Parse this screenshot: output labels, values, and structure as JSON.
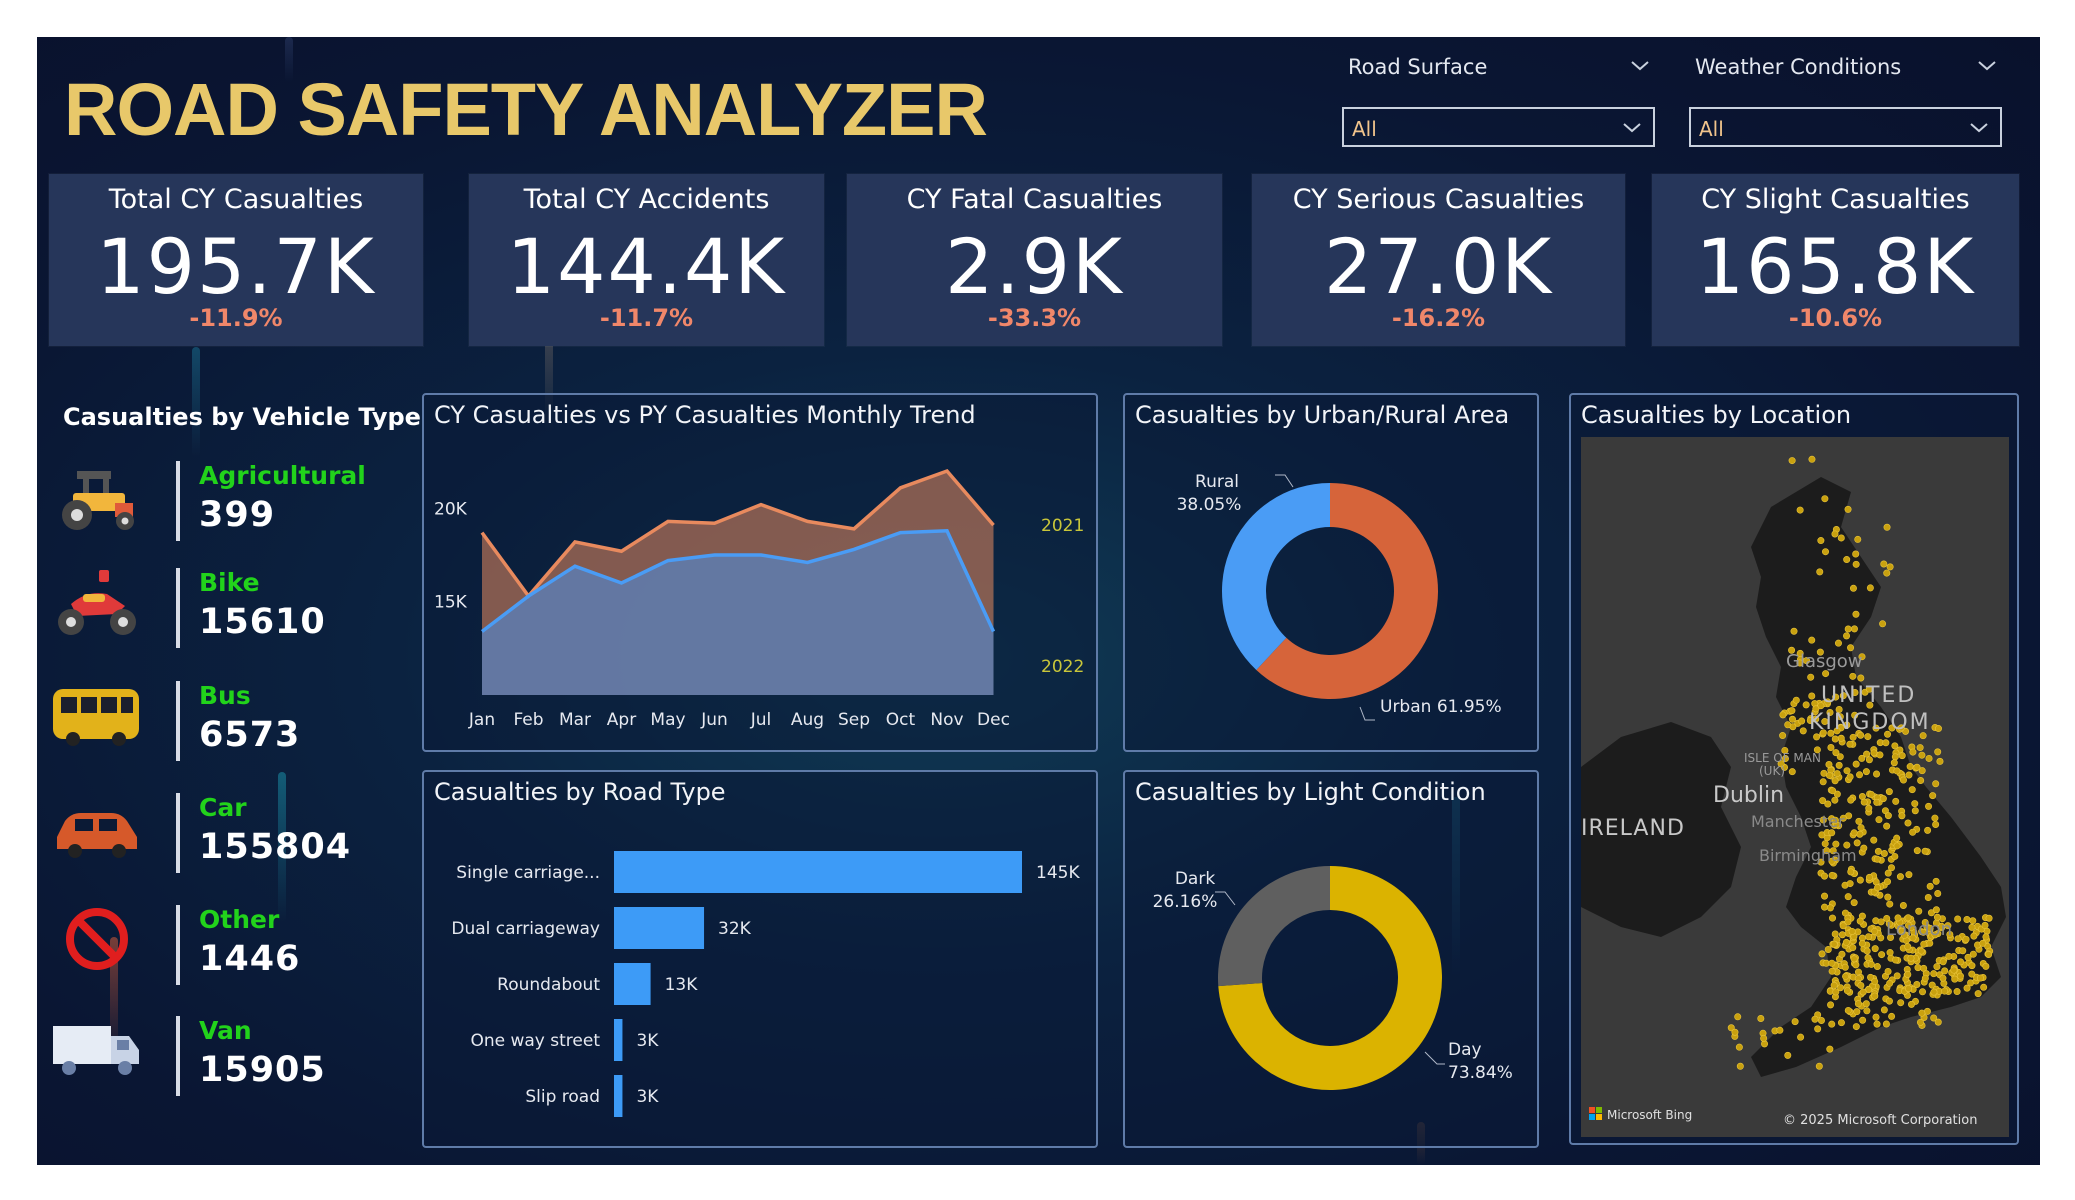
{
  "title": "ROAD SAFETY ANALYZER",
  "slicers": {
    "road_surface": {
      "label": "Road Surface",
      "value": "All"
    },
    "weather": {
      "label": "Weather Conditions",
      "value": "All"
    }
  },
  "kpis": [
    {
      "title": "Total CY Casualties",
      "value": "195.7K",
      "delta": "-11.9%"
    },
    {
      "title": "Total CY Accidents",
      "value": "144.4K",
      "delta": "-11.7%"
    },
    {
      "title": "CY Fatal Casualties",
      "value": "2.9K",
      "delta": "-33.3%"
    },
    {
      "title": "CY Serious Casualties",
      "value": "27.0K",
      "delta": "-16.2%"
    },
    {
      "title": "CY Slight Casualties",
      "value": "165.8K",
      "delta": "-10.6%"
    }
  ],
  "vehicle_types": {
    "title": "Casualties by Vehicle Type",
    "items": [
      {
        "name": "Agricultural",
        "count": "399",
        "icon": "tractor-icon"
      },
      {
        "name": "Bike",
        "count": "15610",
        "icon": "motorbike-icon"
      },
      {
        "name": "Bus",
        "count": "6573",
        "icon": "bus-icon"
      },
      {
        "name": "Car",
        "count": "155804",
        "icon": "car-icon"
      },
      {
        "name": "Other",
        "count": "1446",
        "icon": "no-entry-icon"
      },
      {
        "name": "Van",
        "count": "15905",
        "icon": "van-icon"
      }
    ]
  },
  "panels": {
    "trend": "CY Casualties vs PY Casualties Monthly Trend",
    "urban": "Casualties by Urban/Rural Area",
    "location": "Casualties by Location",
    "road": "Casualties by Road Type",
    "light": "Casualties by Light Condition"
  },
  "map": {
    "labels": [
      "Glasgow",
      "UNITED",
      "KINGDOM",
      "ISLE OF MAN",
      "(UK)",
      "Dublin",
      "Manchester",
      "Birmingham",
      "IRELAND",
      "London"
    ],
    "bing": "Microsoft Bing",
    "copyright": "© 2025 Microsoft Corporation"
  },
  "colors": {
    "cy": "#4a9cf5",
    "py": "#e88a5e",
    "urban": "#d6643a",
    "rural": "#4a9cf5",
    "day": "#dbb300",
    "dark": "#5f5f5f",
    "bar": "#3d9bf7",
    "accent": "#e8c86a"
  },
  "chart_data": [
    {
      "type": "area",
      "title": "CY Casualties vs PY Casualties Monthly Trend",
      "categories": [
        "Jan",
        "Feb",
        "Mar",
        "Apr",
        "May",
        "Jun",
        "Jul",
        "Aug",
        "Sep",
        "Oct",
        "Nov",
        "Dec"
      ],
      "ytick_labels": [
        "20K",
        "15K"
      ],
      "ylim": [
        10000,
        22000
      ],
      "series": [
        {
          "name": "2021",
          "values": [
            18700,
            15300,
            18200,
            17700,
            19300,
            19200,
            20200,
            19300,
            18900,
            21100,
            22000,
            19100
          ]
        },
        {
          "name": "2022",
          "values": [
            13400,
            15300,
            16900,
            16000,
            17200,
            17500,
            17500,
            17100,
            17800,
            18700,
            18800,
            13400
          ]
        }
      ]
    },
    {
      "type": "pie",
      "title": "Casualties by Urban/Rural Area",
      "labels": [
        "Urban",
        "Rural"
      ],
      "values": [
        61.95,
        38.05
      ],
      "value_labels": [
        "61.95%",
        "38.05%"
      ]
    },
    {
      "type": "bar",
      "title": "Casualties by Road Type",
      "categories": [
        "Single carriage...",
        "Dual carriageway",
        "Roundabout",
        "One way street",
        "Slip road"
      ],
      "values": [
        145,
        32,
        13,
        3,
        3
      ],
      "value_labels": [
        "145K",
        "32K",
        "13K",
        "3K",
        "3K"
      ],
      "unit": "K"
    },
    {
      "type": "pie",
      "title": "Casualties by Light Condition",
      "labels": [
        "Day",
        "Dark"
      ],
      "values": [
        73.84,
        26.16
      ],
      "value_labels": [
        "73.84%",
        "26.16%"
      ]
    }
  ]
}
